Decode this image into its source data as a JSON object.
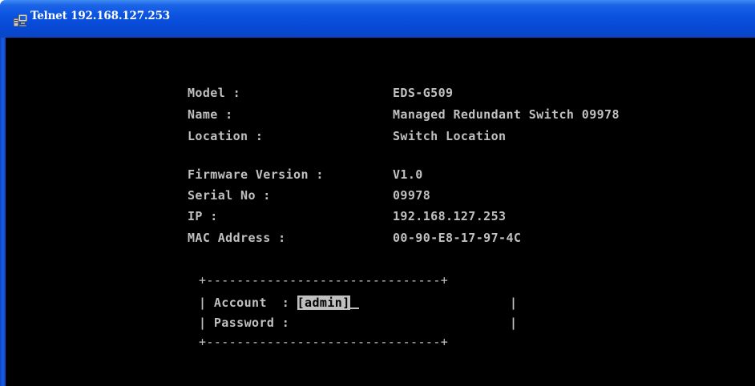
{
  "window": {
    "title": "Telnet 192.168.127.253"
  },
  "info": {
    "model_label": "Model :",
    "model_value": "EDS-G509",
    "name_label": "Name :",
    "name_value": "Managed Redundant Switch 09978",
    "location_label": "Location :",
    "location_value": "Switch Location",
    "firmware_label": "Firmware Version :",
    "firmware_value": "V1.0",
    "serial_label": "Serial No :",
    "serial_value": "09978",
    "ip_label": "IP :",
    "ip_value": "192.168.127.253",
    "mac_label": "MAC Address :",
    "mac_value": "00-90-E8-17-97-4C"
  },
  "login": {
    "border_top": "+-------------------------------+",
    "account_label": "| Account  : ",
    "account_value": "[admin]",
    "account_end": "|",
    "password_label": "| Password :",
    "password_end": "|",
    "border_bottom": "+-------------------------------+"
  },
  "colors": {
    "terminal_bg": "#000000",
    "terminal_fg": "#c0c0c0",
    "titlebar": "#0a52df"
  },
  "icons": {
    "title": "computer-terminal-icon"
  }
}
